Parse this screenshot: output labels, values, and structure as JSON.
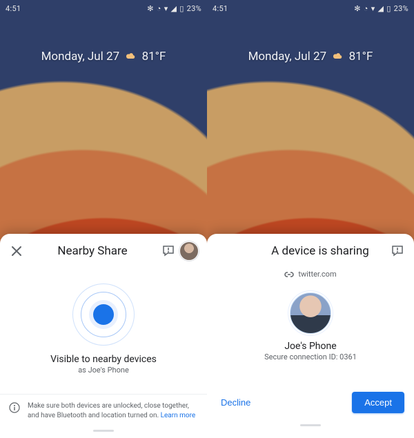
{
  "status": {
    "time": "4:51",
    "battery": "23%"
  },
  "lock": {
    "date": "Monday, Jul 27",
    "temp": "81°F"
  },
  "left": {
    "title": "Nearby Share",
    "visible": "Visible to nearby devices",
    "device_as": "as Joe's Phone",
    "info": "Make sure both devices are unlocked, close together, and have Bluetooth and location turned on.",
    "learn_more": "Learn more"
  },
  "right": {
    "title": "A device is sharing",
    "link_host": "twitter.com",
    "sender_name": "Joe's Phone",
    "secure_id": "Secure connection ID: 0361",
    "decline": "Decline",
    "accept": "Accept"
  }
}
